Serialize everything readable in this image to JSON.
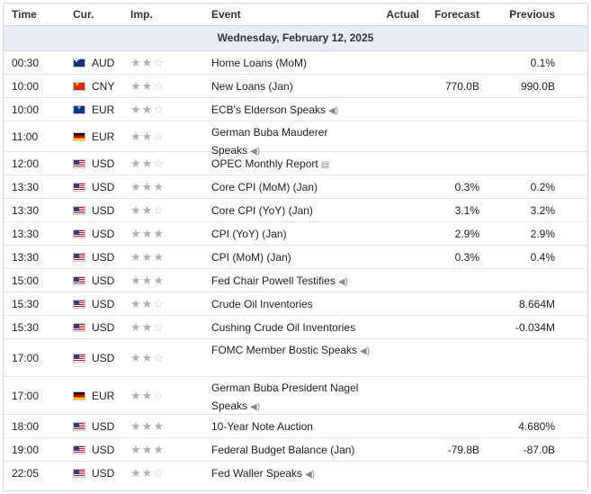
{
  "headers": {
    "time": "Time",
    "currency": "Cur.",
    "importance": "Imp.",
    "event": "Event",
    "actual": "Actual",
    "forecast": "Forecast",
    "previous": "Previous"
  },
  "date_label": "Wednesday, February 12, 2025",
  "rows": [
    {
      "time": "00:30",
      "flag": "au",
      "currency": "AUD",
      "importance": 2,
      "event": "Home Loans (MoM)",
      "icon": "",
      "actual": "",
      "forecast": "",
      "previous": "0.1%"
    },
    {
      "time": "10:00",
      "flag": "cn",
      "currency": "CNY",
      "importance": 2,
      "event": "New Loans (Jan)",
      "icon": "",
      "actual": "",
      "forecast": "770.0B",
      "previous": "990.0B"
    },
    {
      "time": "10:00",
      "flag": "eu",
      "currency": "EUR",
      "importance": 2,
      "event": "ECB's Elderson Speaks",
      "icon": "sound-icon",
      "actual": "",
      "forecast": "",
      "previous": ""
    },
    {
      "time": "11:00",
      "flag": "de",
      "currency": "EUR",
      "importance": 2,
      "event": "German Buba Mauderer Speaks",
      "icon": "sound-icon",
      "actual": "",
      "forecast": "",
      "previous": ""
    },
    {
      "time": "12:00",
      "flag": "us",
      "currency": "USD",
      "importance": 2,
      "event": "OPEC Monthly Report",
      "icon": "report-icon",
      "actual": "",
      "forecast": "",
      "previous": ""
    },
    {
      "time": "13:30",
      "flag": "us",
      "currency": "USD",
      "importance": 3,
      "event": "Core CPI (MoM) (Jan)",
      "icon": "",
      "actual": "",
      "forecast": "0.3%",
      "previous": "0.2%"
    },
    {
      "time": "13:30",
      "flag": "us",
      "currency": "USD",
      "importance": 2,
      "event": "Core CPI (YoY) (Jan)",
      "icon": "",
      "actual": "",
      "forecast": "3.1%",
      "previous": "3.2%"
    },
    {
      "time": "13:30",
      "flag": "us",
      "currency": "USD",
      "importance": 3,
      "event": "CPI (YoY) (Jan)",
      "icon": "",
      "actual": "",
      "forecast": "2.9%",
      "previous": "2.9%"
    },
    {
      "time": "13:30",
      "flag": "us",
      "currency": "USD",
      "importance": 3,
      "event": "CPI (MoM) (Jan)",
      "icon": "",
      "actual": "",
      "forecast": "0.3%",
      "previous": "0.4%"
    },
    {
      "time": "15:00",
      "flag": "us",
      "currency": "USD",
      "importance": 3,
      "event": "Fed Chair Powell Testifies",
      "icon": "sound-icon",
      "actual": "",
      "forecast": "",
      "previous": ""
    },
    {
      "time": "15:30",
      "flag": "us",
      "currency": "USD",
      "importance": 2,
      "event": "Crude Oil Inventories",
      "icon": "",
      "actual": "",
      "forecast": "",
      "previous": "8.664M"
    },
    {
      "time": "15:30",
      "flag": "us",
      "currency": "USD",
      "importance": 2,
      "event": "Cushing Crude Oil Inventories",
      "icon": "",
      "actual": "",
      "forecast": "",
      "previous": "-0.034M"
    },
    {
      "time": "17:00",
      "flag": "us",
      "currency": "USD",
      "importance": 2,
      "event": "FOMC Member Bostic Speaks",
      "icon": "sound-icon",
      "actual": "",
      "forecast": "",
      "previous": ""
    },
    {
      "time": "17:00",
      "flag": "de",
      "currency": "EUR",
      "importance": 2,
      "event": "German Buba President Nagel Speaks",
      "icon": "sound-icon",
      "actual": "",
      "forecast": "",
      "previous": ""
    },
    {
      "time": "18:00",
      "flag": "us",
      "currency": "USD",
      "importance": 3,
      "event": "10-Year Note Auction",
      "icon": "",
      "actual": "",
      "forecast": "",
      "previous": "4.680%"
    },
    {
      "time": "19:00",
      "flag": "us",
      "currency": "USD",
      "importance": 3,
      "event": "Federal Budget Balance (Jan)",
      "icon": "",
      "actual": "",
      "forecast": "-79.8B",
      "previous": "-87.0B"
    },
    {
      "time": "22:05",
      "flag": "us",
      "currency": "USD",
      "importance": 2,
      "event": "Fed Waller Speaks",
      "icon": "sound-icon",
      "actual": "",
      "forecast": "",
      "previous": ""
    }
  ]
}
